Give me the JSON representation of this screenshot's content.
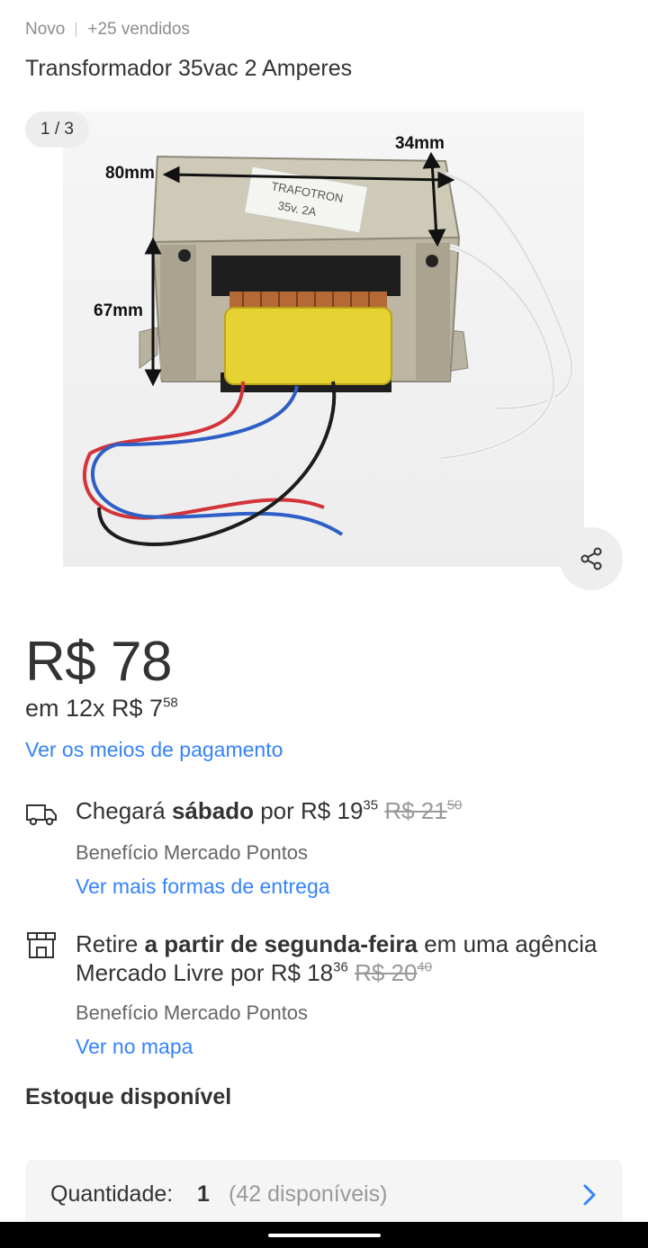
{
  "header": {
    "condition": "Novo",
    "sold": "+25 vendidos",
    "title": "Transformador 35vac 2 Amperes"
  },
  "gallery": {
    "counter": "1 / 3",
    "photo_labels": {
      "depth": "34mm",
      "width": "80mm",
      "height": "67mm",
      "brand": "TRAFOTRON",
      "rating": "35v. 2A"
    }
  },
  "price": {
    "main": "R$ 78",
    "installments_prefix": "em 12x R$ 7",
    "installments_cents": "58",
    "payment_link": "Ver os meios de pagamento"
  },
  "delivery": {
    "icon": "truck-icon",
    "text_prefix": "Chegará ",
    "text_bold": "sábado",
    "text_mid": " por R$ 19",
    "price_cents": "35",
    "old_price": "R$ 21",
    "old_price_cents": "50",
    "benefit": "Benefício Mercado Pontos",
    "link": "Ver mais formas de entrega"
  },
  "pickup": {
    "icon": "store-icon",
    "text_prefix": "Retire ",
    "text_bold": "a partir de segunda-feira",
    "text_suffix": " em uma agência",
    "line2_prefix": "Mercado Livre por R$ 18",
    "price_cents": "36",
    "old_price": "R$ 20",
    "old_price_cents": "40",
    "benefit": "Benefício Mercado Pontos",
    "link": "Ver no mapa"
  },
  "stock": {
    "label": "Estoque disponível"
  },
  "quantity": {
    "label": "Quantidade:",
    "value": "1",
    "available": "(42 disponíveis)"
  },
  "colors": {
    "link": "#3483fa",
    "text": "#333333",
    "muted": "#999999"
  }
}
